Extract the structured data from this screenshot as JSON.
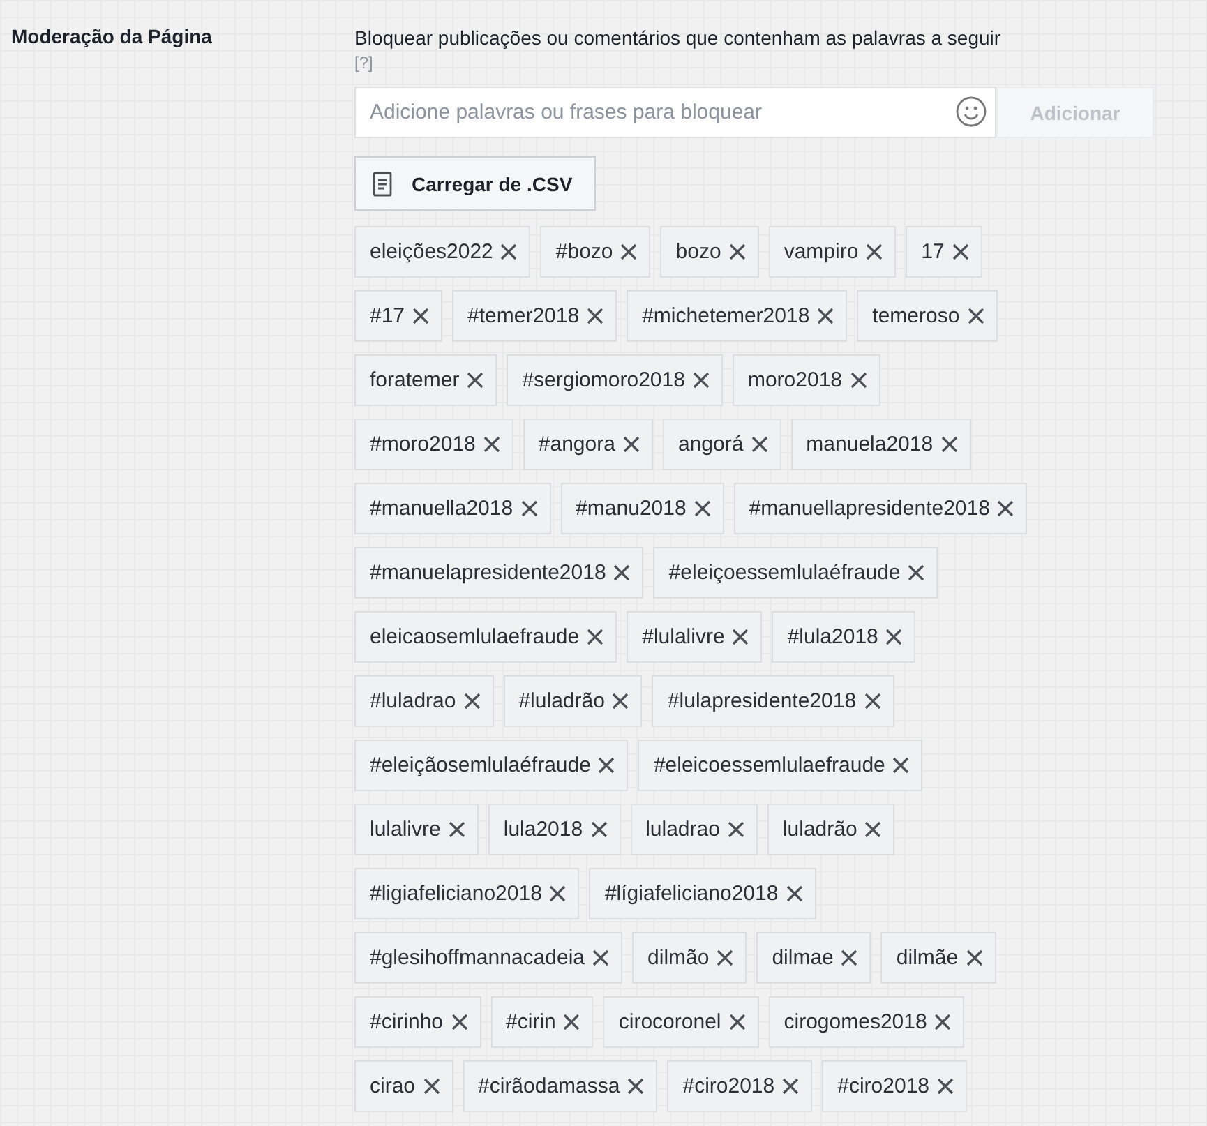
{
  "section_label": "Moderação da Página",
  "description": "Bloquear publicações ou comentários que contenham as palavras a seguir",
  "help_link": "[?]",
  "word_field": {
    "placeholder": "Adicione palavras ou frases para bloquear"
  },
  "add_button": {
    "label": "Adicionar",
    "disabled": true
  },
  "upload_button": {
    "label": "Carregar de .CSV"
  },
  "tag_rows": [
    [
      "eleições2022",
      "#bozo",
      "bozo",
      "vampiro",
      "17"
    ],
    [
      "#17",
      "#temer2018",
      "#michetemer2018",
      "temeroso"
    ],
    [
      "foratemer",
      "#sergiomoro2018",
      "moro2018"
    ],
    [
      "#moro2018",
      "#angora",
      "angorá",
      "manuela2018"
    ],
    [
      "#manuella2018",
      "#manu2018",
      "#manuellapresidente2018"
    ],
    [
      "#manuelapresidente2018",
      "#eleiçoessemlulaéfraude"
    ],
    [
      "eleicaosemlulaefraude",
      "#lulalivre",
      "#lula2018"
    ],
    [
      "#luladrao",
      "#luladrão",
      "#lulapresidente2018"
    ],
    [
      "#eleiçãosemlulaéfraude",
      "#eleicoessemlulaefraude"
    ],
    [
      "lulalivre",
      "lula2018",
      "luladrao",
      "luladrão"
    ],
    [
      "#ligiafeliciano2018",
      "#lígiafeliciano2018"
    ],
    [
      "#glesihoffmannacadeia",
      "dilmão",
      "dilmae",
      "dilmãe"
    ],
    [
      "#cirinho",
      "#cirin",
      "cirocoronel",
      "cirogomes2018"
    ],
    [
      "cirao",
      "#cirãodamassa",
      "#ciro2018",
      "#ciro2018"
    ]
  ]
}
